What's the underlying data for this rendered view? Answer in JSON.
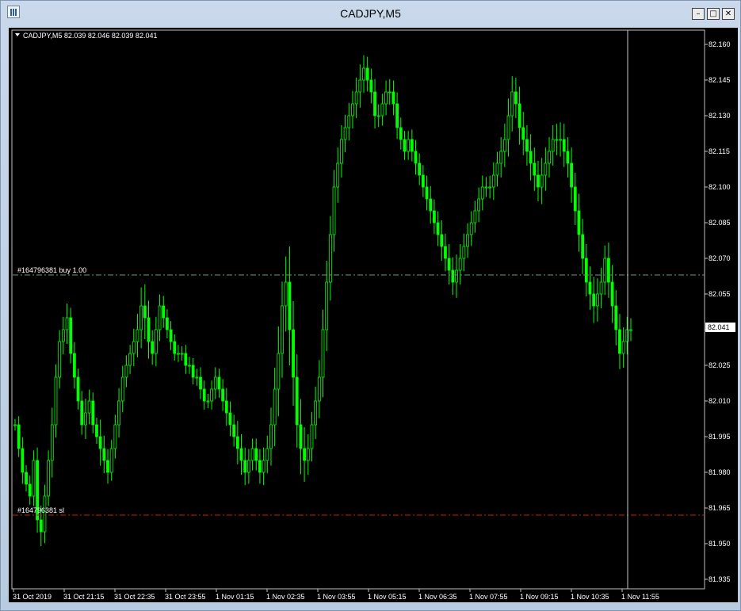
{
  "window": {
    "title": "CADJPY,M5"
  },
  "header": {
    "symbol_line": "CADJPY,M5  82.039 82.046 82.039 82.041"
  },
  "orders": {
    "buy_label": "#164796381 buy 1.00",
    "sl_label": "#164796381 sl",
    "buy_price": 82.063,
    "sl_price": 81.962,
    "buy_color": "#6b9f6b",
    "sl_color": "#d11a1a"
  },
  "price_tag": {
    "label": "82.041",
    "value": 82.041
  },
  "chart_data": {
    "type": "candlestick",
    "symbol": "CADJPY",
    "timeframe": "M5",
    "y_ticks": [
      "82.160",
      "82.145",
      "82.130",
      "82.115",
      "82.100",
      "82.085",
      "82.070",
      "82.055",
      "82.040",
      "82.025",
      "82.010",
      "81.995",
      "81.980",
      "81.965",
      "81.950",
      "81.935"
    ],
    "ylim": [
      81.931,
      82.166
    ],
    "x_ticks": [
      "31 Oct 2019",
      "31 Oct 21:15",
      "31 Oct 22:35",
      "31 Oct 23:55",
      "1 Nov 01:15",
      "1 Nov 02:35",
      "1 Nov 03:55",
      "1 Nov 05:15",
      "1 Nov 06:35",
      "1 Nov 07:55",
      "1 Nov 09:15",
      "1 Nov 10:35",
      "1 Nov 11:55"
    ],
    "last_price": 82.041,
    "candle_color": "#00ff00",
    "background": "#000000",
    "closes": [
      82.0,
      81.99,
      81.98,
      81.975,
      81.97,
      81.985,
      81.96,
      81.955,
      81.97,
      81.985,
      82.0,
      82.02,
      82.035,
      82.04,
      82.045,
      82.03,
      82.02,
      82.01,
      82.0,
      82.005,
      82.01,
      82.0,
      81.995,
      81.99,
      81.985,
      81.98,
      81.99,
      82.0,
      82.01,
      82.02,
      82.025,
      82.03,
      82.035,
      82.04,
      82.05,
      82.045,
      82.035,
      82.03,
      82.04,
      82.05,
      82.045,
      82.04,
      82.035,
      82.03,
      82.03,
      82.03,
      82.025,
      82.025,
      82.02,
      82.02,
      82.015,
      82.01,
      82.01,
      82.015,
      82.02,
      82.015,
      82.01,
      82.005,
      82.0,
      81.995,
      81.99,
      81.985,
      81.98,
      81.985,
      81.99,
      81.985,
      81.98,
      81.985,
      81.99,
      82.0,
      82.015,
      82.03,
      82.05,
      82.06,
      82.04,
      82.02,
      82.0,
      81.99,
      81.985,
      81.99,
      82.0,
      82.01,
      82.02,
      82.04,
      82.06,
      82.08,
      82.1,
      82.11,
      82.12,
      82.125,
      82.13,
      82.135,
      82.14,
      82.145,
      82.15,
      82.145,
      82.14,
      82.13,
      82.13,
      82.135,
      82.14,
      82.14,
      82.135,
      82.125,
      82.12,
      82.115,
      82.12,
      82.115,
      82.11,
      82.105,
      82.1,
      82.095,
      82.09,
      82.085,
      82.08,
      82.075,
      82.07,
      82.065,
      82.06,
      82.065,
      82.07,
      82.075,
      82.08,
      82.085,
      82.09,
      82.095,
      82.1,
      82.1,
      82.1,
      82.105,
      82.11,
      82.115,
      82.12,
      82.13,
      82.14,
      82.135,
      82.125,
      82.12,
      82.115,
      82.11,
      82.105,
      82.1,
      82.105,
      82.11,
      82.115,
      82.12,
      82.12,
      82.12,
      82.115,
      82.11,
      82.1,
      82.09,
      82.08,
      82.07,
      82.06,
      82.055,
      82.05,
      82.055,
      82.06,
      82.07,
      82.06,
      82.05,
      82.04,
      82.03,
      82.035,
      82.04,
      82.04
    ],
    "amplitude": [
      0.004,
      0.006,
      0.008,
      0.005,
      0.006,
      0.007,
      0.009,
      0.01,
      0.008,
      0.007,
      0.012,
      0.009,
      0.008,
      0.009,
      0.01,
      0.007,
      0.008,
      0.006,
      0.007,
      0.01,
      0.008,
      0.006,
      0.005,
      0.012,
      0.009,
      0.008,
      0.006,
      0.007,
      0.009,
      0.008,
      0.007,
      0.006,
      0.009,
      0.011,
      0.013,
      0.015,
      0.012,
      0.008,
      0.009,
      0.008,
      0.007,
      0.006,
      0.006,
      0.005,
      0.006,
      0.005,
      0.006,
      0.006,
      0.005,
      0.006,
      0.007,
      0.006,
      0.005,
      0.006,
      0.007,
      0.006,
      0.007,
      0.009,
      0.008,
      0.007,
      0.011,
      0.01,
      0.009,
      0.008,
      0.007,
      0.007,
      0.008,
      0.009,
      0.009,
      0.012,
      0.015,
      0.019,
      0.017,
      0.018,
      0.025,
      0.02,
      0.016,
      0.018,
      0.015,
      0.01,
      0.009,
      0.01,
      0.012,
      0.014,
      0.015,
      0.013,
      0.012,
      0.011,
      0.01,
      0.009,
      0.009,
      0.009,
      0.01,
      0.011,
      0.009,
      0.008,
      0.008,
      0.009,
      0.008,
      0.007,
      0.008,
      0.009,
      0.008,
      0.008,
      0.007,
      0.006,
      0.006,
      0.007,
      0.008,
      0.007,
      0.007,
      0.008,
      0.009,
      0.008,
      0.008,
      0.01,
      0.009,
      0.01,
      0.009,
      0.011,
      0.01,
      0.009,
      0.008,
      0.008,
      0.007,
      0.008,
      0.008,
      0.007,
      0.008,
      0.009,
      0.008,
      0.01,
      0.011,
      0.012,
      0.011,
      0.01,
      0.012,
      0.011,
      0.01,
      0.012,
      0.011,
      0.01,
      0.012,
      0.011,
      0.01,
      0.01,
      0.011,
      0.012,
      0.011,
      0.01,
      0.011,
      0.01,
      0.012,
      0.011,
      0.01,
      0.011,
      0.012,
      0.011,
      0.01,
      0.009,
      0.011,
      0.012,
      0.011,
      0.011,
      0.01,
      0.009,
      0.008
    ]
  }
}
